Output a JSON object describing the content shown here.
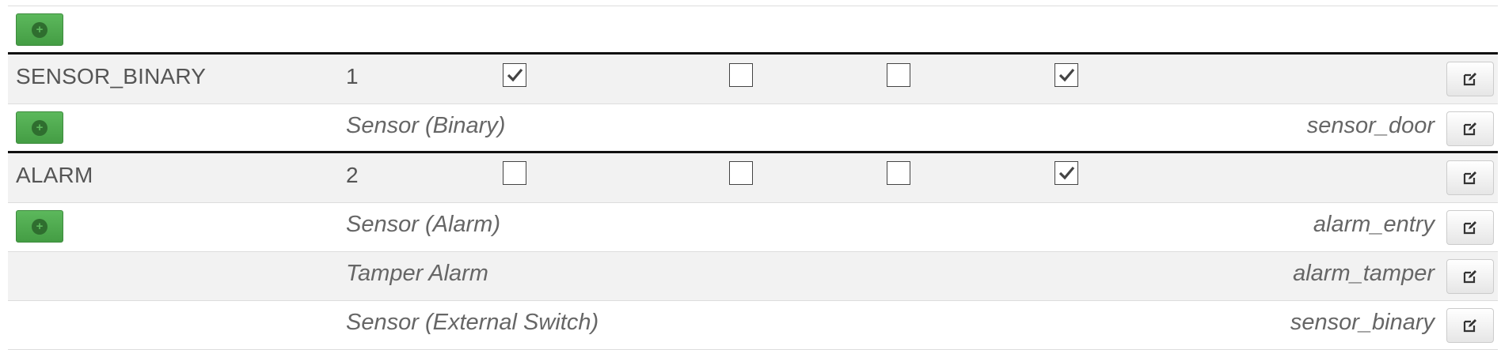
{
  "colors": {
    "add_button": "#5cb85c",
    "row_alt": "#f2f2f2",
    "separator": "#111111"
  },
  "icons": {
    "add": "plus-circle-icon",
    "edit": "edit-icon",
    "check": "check-icon"
  },
  "top_row": {
    "add_label": "+"
  },
  "groups": [
    {
      "name": "SENSOR_BINARY",
      "number": "1",
      "checks": [
        true,
        false,
        false,
        true
      ],
      "items": [
        {
          "description": "Sensor (Binary)",
          "id": "sensor_door",
          "has_add": true
        }
      ]
    },
    {
      "name": "ALARM",
      "number": "2",
      "checks": [
        false,
        false,
        false,
        true
      ],
      "items": [
        {
          "description": "Sensor (Alarm)",
          "id": "alarm_entry",
          "has_add": true
        },
        {
          "description": "Tamper Alarm",
          "id": "alarm_tamper",
          "has_add": false
        },
        {
          "description": "Sensor (External Switch)",
          "id": "sensor_binary",
          "has_add": false
        }
      ]
    }
  ]
}
